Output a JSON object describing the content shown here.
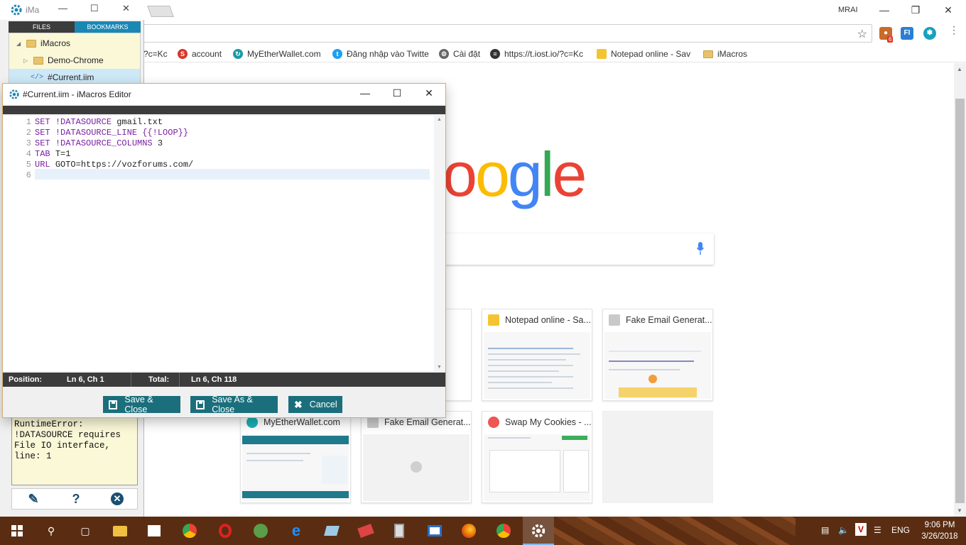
{
  "browser": {
    "profile_name": "MRAI",
    "extension_badge": "6",
    "extensions": [
      "FI"
    ],
    "bookmarks": [
      {
        "label": "?c=Kc",
        "icon": "page-icon"
      },
      {
        "label": "account",
        "icon": "s-icon"
      },
      {
        "label": "MyEtherWallet.com",
        "icon": "mew-icon"
      },
      {
        "label": "Đăng nhập vào Twitte",
        "icon": "twitter-icon"
      },
      {
        "label": "Cài đặt",
        "icon": "gear-icon"
      },
      {
        "label": "https://t.iost.io/?c=Kc",
        "icon": "iost-icon"
      },
      {
        "label": "Notepad online - Sav",
        "icon": "notepad-icon"
      },
      {
        "label": "iMacros",
        "icon": "folder-icon"
      }
    ],
    "google_logo": "oogle",
    "tiles": [
      {
        "title": "Notepad online - Sa...",
        "color": "#f4c430"
      },
      {
        "title": "Fake Email Generat...",
        "color": "#c0c0c0"
      },
      {
        "title": "MyEtherWallet.com",
        "color": "#1ab0b6"
      },
      {
        "title": "Fake Email Generat...",
        "color": "#c0c0c0"
      },
      {
        "title": "Swap My Cookies - ...",
        "color": "#e55"
      }
    ]
  },
  "imacros_panel": {
    "title": "iMa",
    "tabs": [
      "FILES",
      "BOOKMARKS"
    ],
    "tree": [
      {
        "label": "iMacros",
        "type": "folder"
      },
      {
        "label": "Demo-Chrome",
        "type": "folder"
      },
      {
        "label": "#Current.iim",
        "type": "file"
      }
    ],
    "error_text": "RuntimeError:\n!DATASOURCE requires\nFile IO interface,\nline: 1"
  },
  "editor": {
    "title": "#Current.iim - iMacros Editor",
    "lines": [
      {
        "n": "1",
        "parts": [
          [
            "kw",
            "SET "
          ],
          [
            "var",
            "!DATASOURCE"
          ],
          [
            "plain",
            " gmail.txt"
          ]
        ]
      },
      {
        "n": "2",
        "parts": [
          [
            "kw",
            "SET "
          ],
          [
            "var",
            "!DATASOURCE_LINE"
          ],
          [
            "plain",
            " "
          ],
          [
            "var",
            "{{!LOOP}}"
          ]
        ]
      },
      {
        "n": "3",
        "parts": [
          [
            "kw",
            "SET "
          ],
          [
            "var",
            "!DATASOURCE_COLUMNS"
          ],
          [
            "plain",
            " 3"
          ]
        ]
      },
      {
        "n": "4",
        "parts": [
          [
            "kw",
            "TAB "
          ],
          [
            "plain",
            "T=1"
          ]
        ]
      },
      {
        "n": "5",
        "parts": [
          [
            "kw",
            "URL "
          ],
          [
            "plain",
            "GOTO=https://vozforums.com/"
          ]
        ]
      },
      {
        "n": "6",
        "parts": []
      }
    ],
    "status": {
      "position_label": "Position:",
      "position_value": "Ln 6, Ch 1",
      "total_label": "Total:",
      "total_value": "Ln 6, Ch 118"
    },
    "buttons": {
      "save_close": "Save & Close",
      "save_as_close": "Save As & Close",
      "cancel": "Cancel"
    }
  },
  "taskbar": {
    "language": "ENG",
    "time": "9:06 PM",
    "date": "3/26/2018"
  }
}
